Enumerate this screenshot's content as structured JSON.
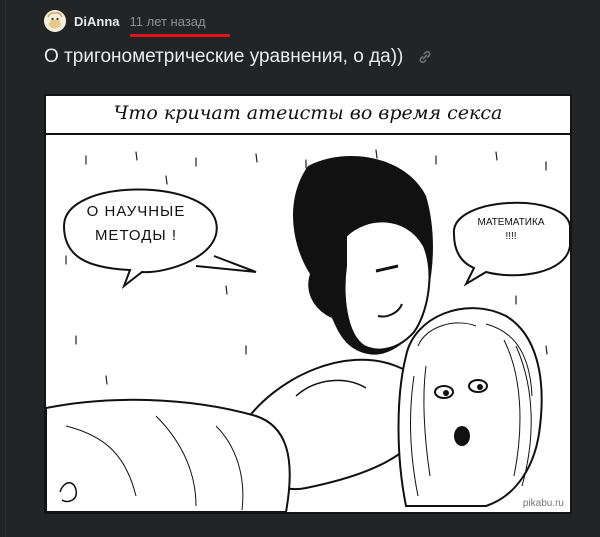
{
  "post": {
    "author": "DiAnna",
    "time": "11 лет назад",
    "title": "О тригонометрические уравнения, о да))"
  },
  "comic": {
    "heading": "Что кричат атеисты во время секса",
    "bubble_left_line1": "О НАУЧНЫЕ",
    "bubble_left_line2": "МЕТОДЫ !",
    "bubble_right_line1": "МАТЕМАТИКА",
    "bubble_right_line2": "!!!!",
    "watermark": "pikabu.ru"
  },
  "colors": {
    "background": "#232426",
    "accent_underline": "#e0141b",
    "muted_text": "#8e9196"
  },
  "icons": [
    "avatar-icon",
    "link-icon"
  ]
}
